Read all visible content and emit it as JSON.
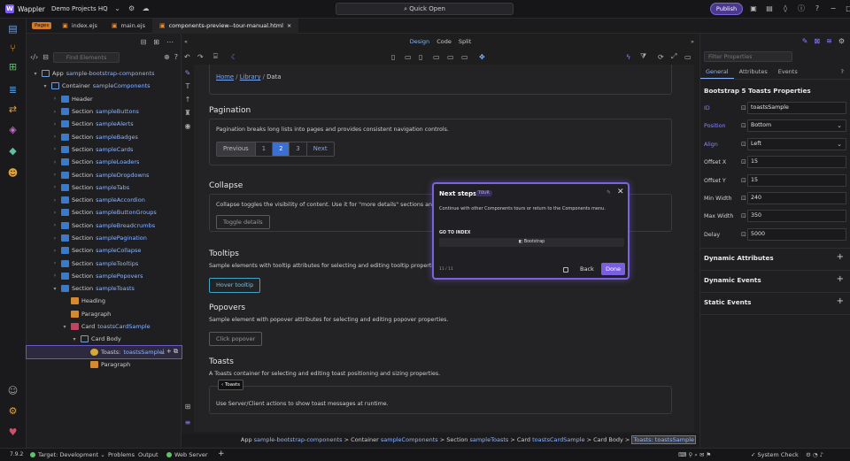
{
  "app": {
    "logo_text": "Wappler",
    "project": "Demo Projects HQ",
    "quick_open": "Quick Open",
    "publish": "Publish"
  },
  "tabs": {
    "pages_chip": "Pages",
    "files": [
      {
        "label": "index.ejs"
      },
      {
        "label": "main.ejs"
      },
      {
        "label": "components-preview--tour-manual.html",
        "close": "×"
      }
    ]
  },
  "nav": {
    "search_placeholder": "Find Elements",
    "tree": [
      {
        "indent": 0,
        "chev": "▾",
        "icon": "blue2",
        "name": "App",
        "id": "sample-bootstrap-components"
      },
      {
        "indent": 1,
        "chev": "▾",
        "icon": "blue2",
        "name": "Container",
        "id": "sampleComponents"
      },
      {
        "indent": 2,
        "chev": "›",
        "icon": "blue",
        "name": "Header",
        "id": ""
      },
      {
        "indent": 2,
        "chev": "›",
        "icon": "blue",
        "name": "Section",
        "id": "sampleButtons"
      },
      {
        "indent": 2,
        "chev": "›",
        "icon": "blue",
        "name": "Section",
        "id": "sampleAlerts"
      },
      {
        "indent": 2,
        "chev": "›",
        "icon": "blue",
        "name": "Section",
        "id": "sampleBadges"
      },
      {
        "indent": 2,
        "chev": "›",
        "icon": "blue",
        "name": "Section",
        "id": "sampleCards"
      },
      {
        "indent": 2,
        "chev": "›",
        "icon": "blue",
        "name": "Section",
        "id": "sampleLoaders"
      },
      {
        "indent": 2,
        "chev": "›",
        "icon": "blue",
        "name": "Section",
        "id": "sampleDropdowns"
      },
      {
        "indent": 2,
        "chev": "›",
        "icon": "blue",
        "name": "Section",
        "id": "sampleTabs"
      },
      {
        "indent": 2,
        "chev": "›",
        "icon": "blue",
        "name": "Section",
        "id": "sampleAccordion"
      },
      {
        "indent": 2,
        "chev": "›",
        "icon": "blue",
        "name": "Section",
        "id": "sampleButtonGroups"
      },
      {
        "indent": 2,
        "chev": "›",
        "icon": "blue",
        "name": "Section",
        "id": "sampleBreadcrumbs"
      },
      {
        "indent": 2,
        "chev": "›",
        "icon": "blue",
        "name": "Section",
        "id": "samplePagination"
      },
      {
        "indent": 2,
        "chev": "›",
        "icon": "blue",
        "name": "Section",
        "id": "sampleCollapse"
      },
      {
        "indent": 2,
        "chev": "›",
        "icon": "blue",
        "name": "Section",
        "id": "sampleTooltips"
      },
      {
        "indent": 2,
        "chev": "›",
        "icon": "blue",
        "name": "Section",
        "id": "samplePopovers"
      },
      {
        "indent": 2,
        "chev": "▾",
        "icon": "blue",
        "name": "Section",
        "id": "sampleToasts"
      },
      {
        "indent": 3,
        "chev": "",
        "icon": "orange",
        "name": "Heading",
        "id": ""
      },
      {
        "indent": 3,
        "chev": "",
        "icon": "orange",
        "name": "Paragraph",
        "id": ""
      },
      {
        "indent": 3,
        "chev": "▾",
        "icon": "red",
        "name": "Card",
        "id": "toastsCardSample"
      },
      {
        "indent": 4,
        "chev": "▾",
        "icon": "blue2",
        "name": "Card Body",
        "id": ""
      },
      {
        "indent": 5,
        "chev": "",
        "icon": "yel",
        "name": "Toasts:",
        "id": "toastsSample",
        "selected": true
      },
      {
        "indent": 5,
        "chev": "",
        "icon": "orange",
        "name": "Paragraph",
        "id": ""
      }
    ]
  },
  "canvas_bar": {
    "design": "Design",
    "code": "Code",
    "split": "Split"
  },
  "page": {
    "breadcrumb": {
      "home": "Home",
      "library": "Library",
      "current": "Data",
      "sep": "/"
    },
    "pagination": {
      "title": "Pagination",
      "text": "Pagination breaks long lists into pages and provides consistent navigation controls.",
      "items": [
        "Previous",
        "1",
        "2",
        "3",
        "Next"
      ]
    },
    "collapse": {
      "title": "Collapse",
      "text": "Collapse toggles the visibility of content. Use it for \"more details\" sections and comp",
      "button": "Toggle details"
    },
    "tooltips": {
      "title": "Tooltips",
      "text": "Sample elements with tooltip attributes for selecting and editing tooltip properties.",
      "button": "Hover tooltip"
    },
    "popovers": {
      "title": "Popovers",
      "text": "Sample element with popover attributes for selecting and editing popover properties.",
      "button": "Click popover"
    },
    "toasts": {
      "title": "Toasts",
      "text": "A Toasts container for selecting and editing toast positioning and sizing properties.",
      "chip": "Toasts",
      "card_text": "Use Server/Client actions to show toast messages at runtime."
    }
  },
  "tour": {
    "title": "Next steps",
    "badge": "TOUR",
    "text": "Continue with other Components tours or return to the Components menu.",
    "go_index": "GO TO INDEX",
    "bootstrap": "Bootstrap",
    "counter": "11 / 11",
    "back": "Back",
    "done": "Done"
  },
  "status_path": {
    "parts": [
      {
        "t": "App ",
        "h": "sample-bootstrap-components"
      },
      {
        "t": " > Container ",
        "h": "sampleComponents"
      },
      {
        "t": " > Section ",
        "h": "sampleToasts"
      },
      {
        "t": " > Card ",
        "h": "toastsCardSample"
      },
      {
        "t": " > Card Body > ",
        "h": ""
      }
    ],
    "selected": "Toasts: toastsSample"
  },
  "props": {
    "filter_placeholder": "Filter Properties",
    "tabs": [
      "General",
      "Attributes",
      "Events"
    ],
    "title": "Bootstrap 5 Toasts Properties",
    "rows": [
      {
        "label": "ID",
        "value": "toastsSample",
        "blue": true,
        "dd": ""
      },
      {
        "label": "Position",
        "value": "Bottom",
        "blue": true,
        "dd": "⌄"
      },
      {
        "label": "Align",
        "value": "Left",
        "blue": true,
        "dd": "⌄"
      },
      {
        "label": "Offset X",
        "value": "15",
        "blue": false,
        "dd": ""
      },
      {
        "label": "Offset Y",
        "value": "15",
        "blue": false,
        "dd": ""
      },
      {
        "label": "Min Width",
        "value": "240",
        "blue": false,
        "dd": ""
      },
      {
        "label": "Max Width",
        "value": "350",
        "blue": false,
        "dd": ""
      },
      {
        "label": "Delay",
        "value": "5000",
        "blue": false,
        "dd": ""
      }
    ],
    "sections": [
      "Dynamic Attributes",
      "Dynamic Events",
      "Static Events"
    ]
  },
  "bottom": {
    "version": "7.9.2",
    "target": "Target: Development",
    "problems": "Problems",
    "output": "Output",
    "webserver": "Web Server",
    "plus": "+",
    "syscheck": "System Check"
  },
  "colors": {
    "accent": "#7d62e0",
    "link": "#8fb6ff"
  }
}
